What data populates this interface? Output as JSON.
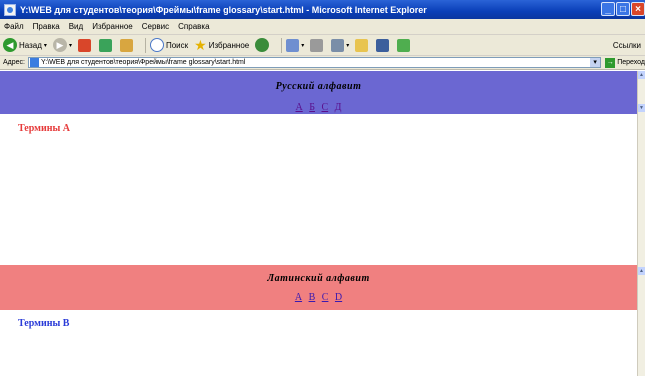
{
  "window": {
    "title": "Y:\\WEB для студентов\\теория\\Фреймы\\frame glossary\\start.html - Microsoft Internet Explorer",
    "controls": [
      "_",
      "□",
      "×"
    ]
  },
  "menu": [
    "Файл",
    "Правка",
    "Вид",
    "Избранное",
    "Сервис",
    "Справка"
  ],
  "toolbar": {
    "back_label": "Назад",
    "search_label": "Поиск",
    "favorites_label": "Избранное",
    "links_label": "Ссылки"
  },
  "address": {
    "label": "Адрес:",
    "url": "Y:\\WEB для студентов\\теория\\Фреймы\\frame glossary\\start.html",
    "go_label": "Переход"
  },
  "frames": {
    "russian": {
      "title": "Русский алфавит",
      "letters": [
        "А",
        "Б",
        "С",
        "Д"
      ],
      "terms_heading": "Термины А"
    },
    "latin": {
      "title": "Латинский алфавит",
      "letters": [
        "A",
        "B",
        "C",
        "D"
      ],
      "terms_heading": "Термины B"
    }
  },
  "colors": {
    "russian_bar": "#6b67d2",
    "latin_bar": "#f08080",
    "terms_a": "#e63a3a",
    "terms_b": "#2a3bd8"
  }
}
